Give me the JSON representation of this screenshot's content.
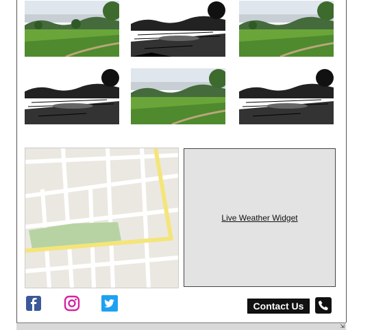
{
  "gallery": {
    "photos": [
      {
        "name": "golf-course-photo-color-1",
        "style": "color"
      },
      {
        "name": "golf-course-photo-bw-1",
        "style": "bw"
      },
      {
        "name": "golf-course-photo-color-2",
        "style": "color"
      },
      {
        "name": "golf-course-photo-bw-2",
        "style": "bw"
      },
      {
        "name": "golf-course-photo-color-3",
        "style": "color"
      },
      {
        "name": "golf-course-photo-bw-3",
        "style": "bw"
      }
    ]
  },
  "weather_widget": {
    "label": "Live Weather Widget"
  },
  "social": {
    "icons": [
      "facebook-icon",
      "instagram-icon",
      "twitter-icon"
    ],
    "colors": {
      "facebook": "#3b5998",
      "instagram": "#d6249f",
      "twitter": "#1da1f2"
    }
  },
  "contact": {
    "label": "Contact Us",
    "icon": "phone-icon"
  },
  "colors": {
    "map_road_yellow": "#f4e57a",
    "map_park": "#b7d3a3",
    "map_block": "#ebe8e1"
  }
}
